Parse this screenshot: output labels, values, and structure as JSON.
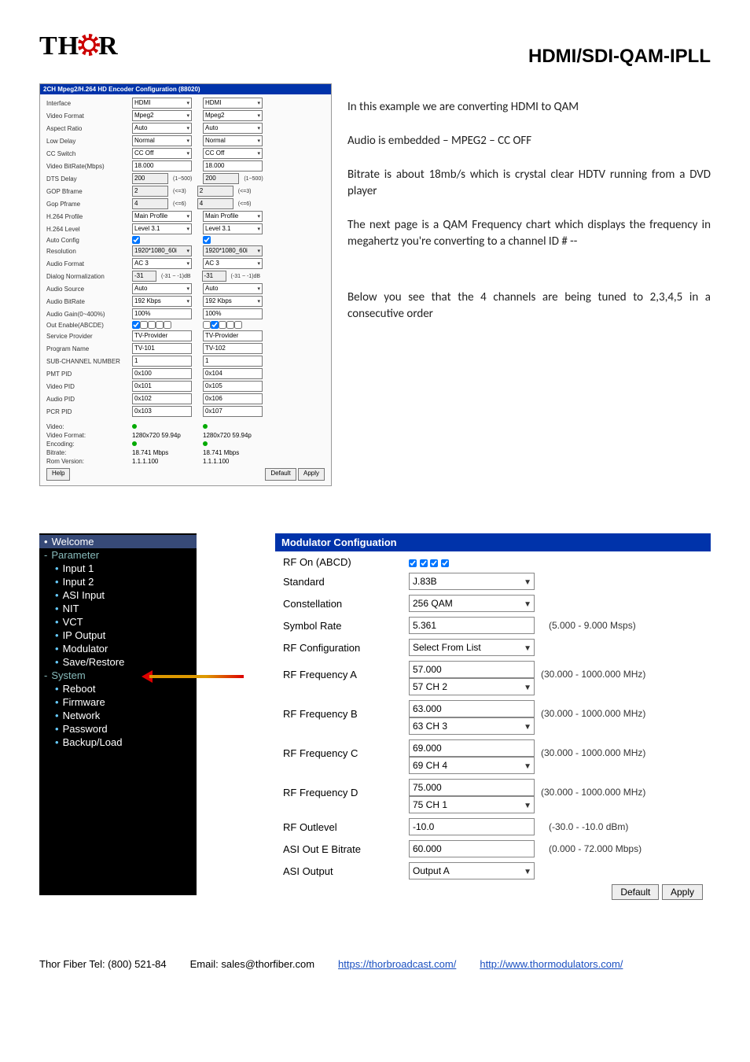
{
  "brand": {
    "name_left": "TH",
    "name_right": "R"
  },
  "page_title": "HDMI/SDI-QAM-IPLL",
  "encoder": {
    "title": "2CH Mpeg2/H.264 HD Encoder Configuration (88020)",
    "rows": {
      "interface": {
        "label": "Interface",
        "a": "HDMI",
        "b": "HDMI"
      },
      "video_format": {
        "label": "Video Format",
        "a": "Mpeg2",
        "b": "Mpeg2"
      },
      "aspect_ratio": {
        "label": "Aspect Ratio",
        "a": "Auto",
        "b": "Auto"
      },
      "low_delay": {
        "label": "Low Delay",
        "a": "Normal",
        "b": "Normal"
      },
      "cc_switch": {
        "label": "CC Switch",
        "a": "CC Off",
        "b": "CC Off"
      },
      "video_bitrate": {
        "label": "Video BitRate(Mbps)",
        "a": "18.000",
        "b": "18.000"
      },
      "dts_delay": {
        "label": "DTS Delay",
        "a": "200",
        "b": "200",
        "hint": "(1~500)"
      },
      "gop_bframe": {
        "label": "GOP Bframe",
        "a": "2",
        "b": "2",
        "hint": "(<=3)"
      },
      "gop_pframe": {
        "label": "Gop Pframe",
        "a": "4",
        "b": "4",
        "hint": "(<=6)"
      },
      "h264_profile": {
        "label": "H.264 Profile",
        "a": "Main Profile",
        "b": "Main Profile"
      },
      "h264_level": {
        "label": "H.264 Level",
        "a": "Level 3.1",
        "b": "Level 3.1"
      },
      "auto_config": {
        "label": "Auto Config",
        "a_checked": true,
        "b_checked": true
      },
      "resolution": {
        "label": "Resolution",
        "a": "1920*1080_60i",
        "b": "1920*1080_60i"
      },
      "audio_format": {
        "label": "Audio Format",
        "a": "AC 3",
        "b": "AC 3"
      },
      "dialog_norm": {
        "label": "Dialog Normalization",
        "a": "-31",
        "b": "-31",
        "hint": "(-31 ~ -1)dB"
      },
      "audio_source": {
        "label": "Audio Source",
        "a": "Auto",
        "b": "Auto"
      },
      "audio_bitrate": {
        "label": "Audio BitRate",
        "a": "192 Kbps",
        "b": "192 Kbps"
      },
      "audio_gain": {
        "label": "Audio Gain(0~400%)",
        "a": "100%",
        "b": "100%"
      },
      "out_enable": {
        "label": "Out Enable(ABCDE)"
      },
      "service_provider": {
        "label": "Service Provider",
        "a": "TV-Provider",
        "b": "TV-Provider"
      },
      "program_name": {
        "label": "Program Name",
        "a": "TV-101",
        "b": "TV-102"
      },
      "sub_channel": {
        "label": "SUB-CHANNEL NUMBER",
        "a": "1",
        "b": "1"
      },
      "pmt_pid": {
        "label": "PMT PID",
        "a": "0x100",
        "b": "0x104"
      },
      "video_pid": {
        "label": "Video PID",
        "a": "0x101",
        "b": "0x105"
      },
      "audio_pid": {
        "label": "Audio PID",
        "a": "0x102",
        "b": "0x106"
      },
      "pcr_pid": {
        "label": "PCR PID",
        "a": "0x103",
        "b": "0x107"
      }
    },
    "status": {
      "video_label": "Video:",
      "video_format_label": "Video Format:",
      "video_format_a": "1280x720 59.94p",
      "video_format_b": "1280x720 59.94p",
      "encoding_label": "Encoding:",
      "bitrate_label": "Bitrate:",
      "bitrate_a": "18.741 Mbps",
      "bitrate_b": "18.741 Mbps",
      "rom_label": "Rom Version:",
      "rom_a": "1.1.1.100",
      "rom_b": "1.1.1.100"
    },
    "buttons": {
      "help": "Help",
      "default": "Default",
      "apply": "Apply"
    }
  },
  "explain": {
    "p1": "In this example we are converting HDMI to QAM",
    "p2": "Audio is embedded – MPEG2 – CC OFF",
    "p3": "Bitrate is about 18mb/s which is crystal clear HDTV running from a DVD player",
    "p4": "The next page is a QAM Frequency chart which displays the frequency in megahertz you're converting to a channel ID # --",
    "p5": "Below you see that the 4 channels are being tuned to 2,3,4,5 in a consecutive order"
  },
  "sidebar": {
    "welcome": "Welcome",
    "parameter": "Parameter",
    "input1": "Input 1",
    "input2": "Input 2",
    "asi_input": "ASI Input",
    "nit": "NIT",
    "vct": "VCT",
    "ip_output": "IP Output",
    "modulator": "Modulator",
    "save_restore": "Save/Restore",
    "system": "System",
    "reboot": "Reboot",
    "firmware": "Firmware",
    "network": "Network",
    "password": "Password",
    "backup_load": "Backup/Load"
  },
  "mod": {
    "title": "Modulator Configuation",
    "rf_on": "RF On (ABCD)",
    "standard_lbl": "Standard",
    "standard_val": "J.83B",
    "constellation_lbl": "Constellation",
    "constellation_val": "256 QAM",
    "symbol_rate_lbl": "Symbol Rate",
    "symbol_rate_val": "5.361",
    "symbol_rate_hint": "(5.000 - 9.000 Msps)",
    "rf_config_lbl": "RF Configuration",
    "rf_config_val": "Select From List",
    "rfa_lbl": "RF Frequency A",
    "rfa_val1": "57.000",
    "rfa_val2": "57 CH 2",
    "rfa_hint": "(30.000 - 1000.000 MHz)",
    "rfb_lbl": "RF Frequency B",
    "rfb_val1": "63.000",
    "rfb_val2": "63 CH 3",
    "rfb_hint": "(30.000 - 1000.000 MHz)",
    "rfc_lbl": "RF Frequency C",
    "rfc_val1": "69.000",
    "rfc_val2": "69 CH 4",
    "rfc_hint": "(30.000 - 1000.000 MHz)",
    "rfd_lbl": "RF Frequency D",
    "rfd_val1": "75.000",
    "rfd_val2": "75 CH 1",
    "rfd_hint": "(30.000 - 1000.000 MHz)",
    "rf_out_lbl": "RF Outlevel",
    "rf_out_val": "-10.0",
    "rf_out_hint": "(-30.0 - -10.0 dBm)",
    "asi_bitrate_lbl": "ASI Out E Bitrate",
    "asi_bitrate_val": "60.000",
    "asi_bitrate_hint": "(0.000 - 72.000 Mbps)",
    "asi_output_lbl": "ASI Output",
    "asi_output_val": "Output A",
    "default_btn": "Default",
    "apply_btn": "Apply"
  },
  "footer": {
    "tel": "Thor Fiber Tel: (800) 521-84",
    "email_lbl": "Email: sales@thorfiber.com",
    "link1": "https://thorbroadcast.com/",
    "link2": "http://www.thormodulators.com/"
  }
}
